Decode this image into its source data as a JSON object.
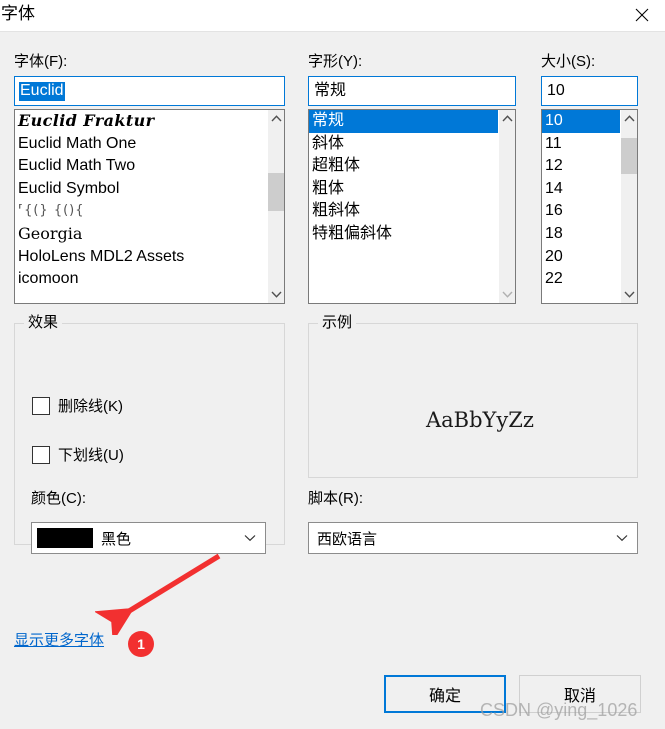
{
  "window": {
    "title": "字体",
    "close_icon": "close-icon"
  },
  "font_family": {
    "label": "字体(F):",
    "value": "Euclid",
    "items": [
      "Euclid Fraktur",
      "Euclid Math One",
      "Euclid Math Two",
      "Euclid Symbol",
      "⸢{(} {(){",
      "Georgia",
      "HoloLens MDL2 Assets",
      "icomoon"
    ],
    "selected_index": -1
  },
  "font_style": {
    "label": "字形(Y):",
    "value": "常规",
    "items": [
      "常规",
      "斜体",
      "超粗体",
      "粗体",
      "粗斜体",
      "特粗偏斜体"
    ],
    "selected_index": 0
  },
  "font_size": {
    "label": "大小(S):",
    "value": "10",
    "items": [
      "10",
      "11",
      "12",
      "14",
      "16",
      "18",
      "20",
      "22"
    ],
    "selected_index": 0
  },
  "effects": {
    "legend": "效果",
    "strikeout": {
      "label": "删除线(K)",
      "checked": false
    },
    "underline": {
      "label": "下划线(U)",
      "checked": false
    },
    "color": {
      "label": "颜色(C):",
      "value": "黑色",
      "swatch": "#000000",
      "chevron_icon": "chevron-down-icon"
    }
  },
  "sample": {
    "legend": "示例",
    "text": "AaBbYyZz"
  },
  "script": {
    "label": "脚本(R):",
    "value": "西欧语言",
    "chevron_icon": "chevron-down-icon"
  },
  "more_fonts_link": "显示更多字体",
  "buttons": {
    "ok": "确定",
    "cancel": "取消"
  },
  "annotation": {
    "badge": "1",
    "arrow_color": "#f23030"
  },
  "watermark": "CSDN @ying_1026",
  "colors": {
    "accent": "#0078d7",
    "dialog_bg": "#f0f0f0",
    "scroll_thumb": "#cdcdcd",
    "link": "#0066cc"
  }
}
